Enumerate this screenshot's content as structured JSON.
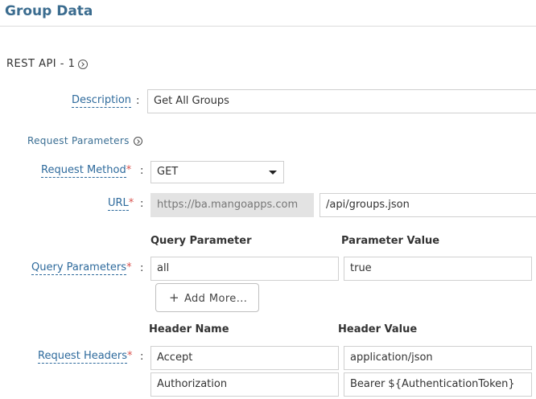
{
  "page": {
    "title": "Group Data"
  },
  "section": {
    "title": "REST API - 1",
    "icon": "chevron-right-circle-icon"
  },
  "description": {
    "label": "Description",
    "value": "Get All Groups"
  },
  "request_parameters": {
    "label": "Request Parameters",
    "icon": "chevron-right-circle-icon"
  },
  "request_method": {
    "label": "Request Method",
    "required_mark": "*",
    "selected": "GET"
  },
  "url": {
    "label": "URL",
    "required_mark": "*",
    "base": "https://ba.mangoapps.com",
    "path": "/api/groups.json"
  },
  "query_parameters": {
    "label": "Query Parameters",
    "required_mark": "*",
    "col_name": "Query Parameter",
    "col_value": "Parameter Value",
    "rows": [
      {
        "name": "all",
        "value": "true"
      }
    ],
    "add_more_label": "Add More...",
    "add_more_icon": "+"
  },
  "request_headers": {
    "label": "Request Headers",
    "required_mark": "*",
    "col_name": "Header Name",
    "col_value": "Header Value",
    "rows": [
      {
        "name": "Accept",
        "value": "application/json"
      },
      {
        "name": "Authorization",
        "value": "Bearer ${AuthenticationToken}"
      }
    ]
  },
  "colon": ":"
}
